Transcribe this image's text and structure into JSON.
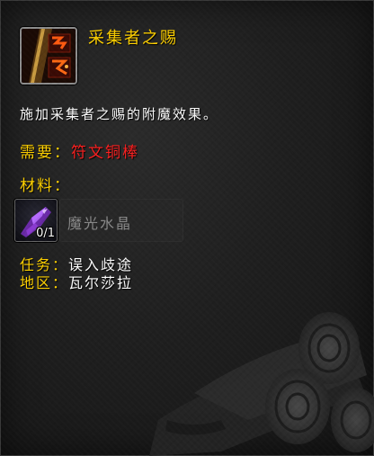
{
  "item": {
    "title": "采集者之赐",
    "icon": "runed-rod-icon"
  },
  "description": "施加采集者之赐的附魔效果。",
  "requirement": {
    "label": "需要：",
    "value": "符文铜棒"
  },
  "materials": {
    "label": "材料：",
    "items": [
      {
        "name": "魔光水晶",
        "count": "0/1",
        "icon": "purple-crystal-icon"
      }
    ]
  },
  "quest": {
    "label": "任务：",
    "value": "误入歧途"
  },
  "zone": {
    "label": "地区：",
    "value": "瓦尔莎拉"
  },
  "colors": {
    "title": "#ffd100",
    "requirement_value": "#ff2020",
    "material_name": "#8a8a8a",
    "text": "#ffffff"
  }
}
